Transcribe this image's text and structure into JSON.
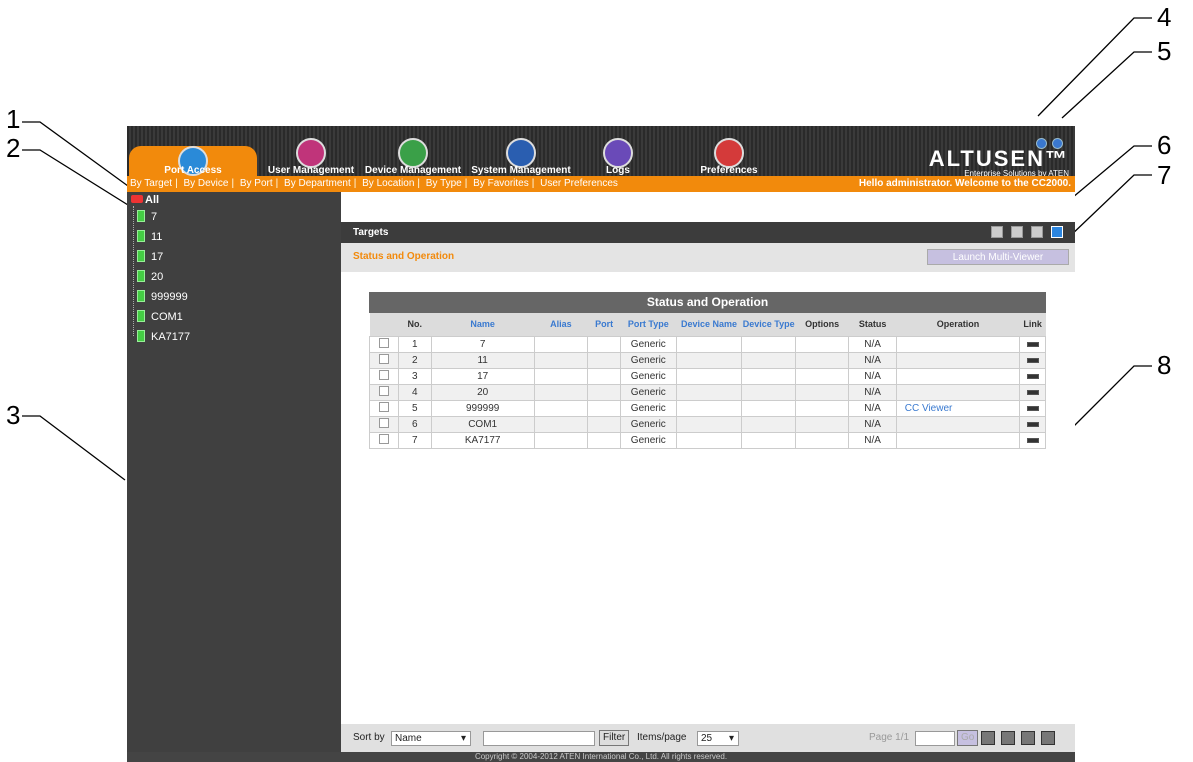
{
  "callouts": [
    "1",
    "2",
    "3",
    "4",
    "5",
    "6",
    "7",
    "8"
  ],
  "nav": {
    "tabs": [
      {
        "label": "Port Access",
        "icon": "port-access-icon",
        "color": "#2a8ad8"
      },
      {
        "label": "User Management",
        "icon": "users-icon",
        "color": "#c0347a"
      },
      {
        "label": "Device Management",
        "icon": "device-icon",
        "color": "#3aa048"
      },
      {
        "label": "System Management",
        "icon": "system-icon",
        "color": "#2a5eb0"
      },
      {
        "label": "Logs",
        "icon": "logs-icon",
        "color": "#6a4ab8"
      },
      {
        "label": "Preferences",
        "icon": "preferences-icon",
        "color": "#d43a3a"
      }
    ]
  },
  "brand": {
    "logo": "ALTUSEN™",
    "tagline": "Enterprise Solutions by ATEN"
  },
  "subnav": {
    "items": [
      "By Target",
      "By Device",
      "By Port",
      "By Department",
      "By Location",
      "By Type",
      "By Favorites",
      "User Preferences"
    ],
    "welcome": "Hello administrator. Welcome to the CC2000."
  },
  "sidebar": {
    "root": "All",
    "items": [
      "7",
      "11",
      "17",
      "20",
      "999999",
      "COM1",
      "KA7177"
    ]
  },
  "main": {
    "targets_label": "Targets",
    "status_title": "Status and Operation",
    "launch_label": "Launch Multi-Viewer",
    "table": {
      "caption": "Status and Operation",
      "headers": [
        "",
        "No.",
        "Name",
        "Alias",
        "Port",
        "Port Type",
        "Device Name",
        "Device Type",
        "Options",
        "Status",
        "Operation",
        "Link"
      ],
      "rows": [
        {
          "no": "1",
          "name": "7",
          "port_type": "Generic",
          "status": "N/A",
          "operation": ""
        },
        {
          "no": "2",
          "name": "11",
          "port_type": "Generic",
          "status": "N/A",
          "operation": ""
        },
        {
          "no": "3",
          "name": "17",
          "port_type": "Generic",
          "status": "N/A",
          "operation": ""
        },
        {
          "no": "4",
          "name": "20",
          "port_type": "Generic",
          "status": "N/A",
          "operation": ""
        },
        {
          "no": "5",
          "name": "999999",
          "port_type": "Generic",
          "status": "N/A",
          "operation": "CC Viewer"
        },
        {
          "no": "6",
          "name": "COM1",
          "port_type": "Generic",
          "status": "N/A",
          "operation": ""
        },
        {
          "no": "7",
          "name": "KA7177",
          "port_type": "Generic",
          "status": "N/A",
          "operation": ""
        }
      ]
    },
    "bottom": {
      "sort_label": "Sort by",
      "sort_value": "Name",
      "filter_label": "Filter",
      "items_label": "Items/page",
      "items_value": "25",
      "page_label": "Page 1/1",
      "go_label": "Go"
    }
  },
  "footer": {
    "copyright": "Copyright © 2004-2012 ATEN International Co., Ltd. All rights reserved."
  }
}
